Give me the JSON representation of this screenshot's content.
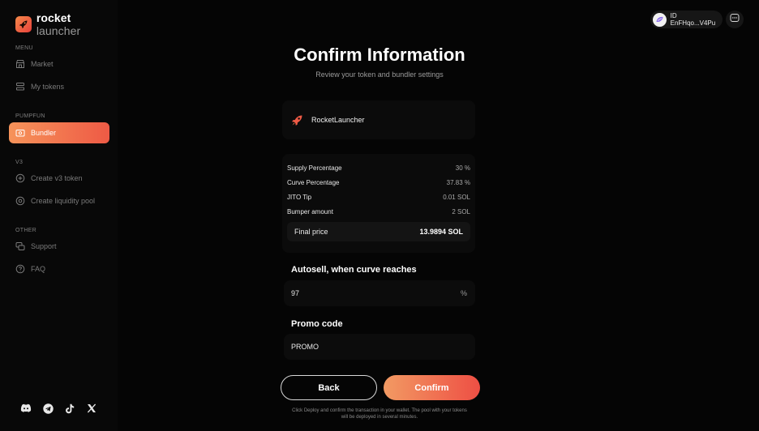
{
  "brand": {
    "name_bold": "rocket",
    "name_light": " launcher"
  },
  "sidebar": {
    "sections": [
      {
        "label": "MENU",
        "items": [
          {
            "label": "Market",
            "icon": "store-icon"
          },
          {
            "label": "My tokens",
            "icon": "layers-icon"
          }
        ]
      },
      {
        "label": "PUMPFUN",
        "items": [
          {
            "label": "Bundler",
            "icon": "bundle-icon",
            "active": true
          }
        ]
      },
      {
        "label": "V3",
        "items": [
          {
            "label": "Create v3 token",
            "icon": "plus-circle-icon"
          },
          {
            "label": "Create liquidity pool",
            "icon": "pool-icon"
          }
        ]
      },
      {
        "label": "OTHER",
        "items": [
          {
            "label": "Support",
            "icon": "support-icon"
          },
          {
            "label": "FAQ",
            "icon": "question-icon"
          }
        ]
      }
    ],
    "socials": [
      "discord-icon",
      "telegram-icon",
      "tiktok-icon",
      "x-icon"
    ]
  },
  "header": {
    "wallet_id": "ID EnFHqo...V4Pu"
  },
  "main": {
    "title": "Confirm Information",
    "subtitle": "Review your token and bundler settings",
    "token_name": "RocketLauncher",
    "details": [
      {
        "label": "Supply Percentage",
        "value": "30 %"
      },
      {
        "label": "Curve Percentage",
        "value": "37.83 %"
      },
      {
        "label": "JITO Tip",
        "value": "0.01 SOL"
      },
      {
        "label": "Bumper amount",
        "value": "2 SOL"
      }
    ],
    "final_price_label": "Final price",
    "final_price_value": "13.9894 SOL",
    "autosell_title": "Autosell, when curve reaches",
    "autosell_value": "97",
    "autosell_suffix": "%",
    "promo_title": "Promo code",
    "promo_value": "PROMO",
    "back_label": "Back",
    "confirm_label": "Confirm",
    "note": "Click Deploy and confirm the transaction in your wallet. The pool with your tokens will be deployed in several minutes."
  },
  "colors": {
    "accent_start": "#f6935a",
    "accent_end": "#ee4f44",
    "background": "#050505"
  }
}
